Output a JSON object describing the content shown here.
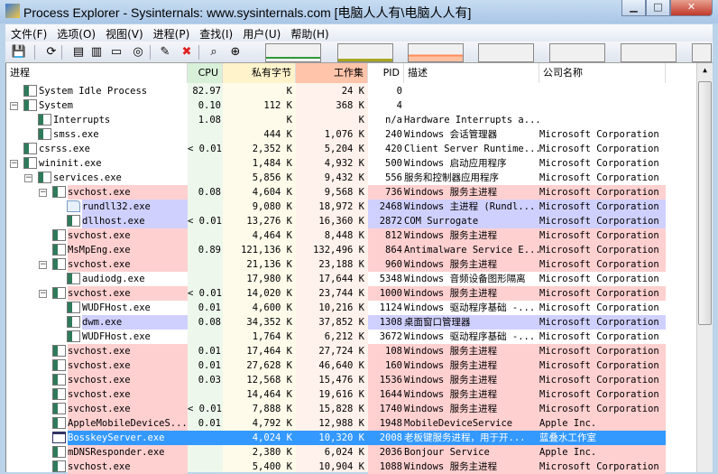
{
  "window": {
    "title": "Process Explorer - Sysinternals: www.sysinternals.com [电脑人人有\\电脑人人有]",
    "minimize": "▁",
    "maximize": "□",
    "close": "✕"
  },
  "menu": [
    "文件(F)",
    "选项(O)",
    "视图(V)",
    "进程(P)",
    "查找(I)",
    "用户(U)",
    "帮助(H)"
  ],
  "toolbar": [
    {
      "icon": "save-icon",
      "glyph": "💾"
    },
    {
      "icon": "refresh-icon",
      "glyph": "⟳"
    },
    {
      "icon": "system-info-icon",
      "glyph": "▤"
    },
    {
      "icon": "handles-icon",
      "glyph": "▥"
    },
    {
      "icon": "lower-pane-icon",
      "glyph": "▭"
    },
    {
      "icon": "properties-icon",
      "glyph": "◎"
    },
    {
      "icon": "window-icon",
      "glyph": "✎"
    },
    {
      "icon": "kill-process-icon",
      "glyph": "✖"
    },
    {
      "icon": "find-icon",
      "glyph": "⌕"
    },
    {
      "icon": "target-icon",
      "glyph": "⊕"
    }
  ],
  "colors": {
    "pink": "#ffd0d0",
    "purple": "#d0d0ff",
    "selected": "#3399ff",
    "cpu_hdr": "#d8f0d8",
    "cpu_col": "#edf7ec",
    "priv_hdr": "#fff3cc",
    "priv_col": "#fffbea",
    "ws_hdr": "#ffc4aa",
    "ws_col": "#fff1eb"
  },
  "columns": {
    "process": "进程",
    "cpu": "CPU",
    "private": "私有字节",
    "working": "工作集",
    "pid": "PID",
    "description": "描述",
    "company": "公司名称"
  },
  "processes": [
    {
      "name": "System Idle Process",
      "level": 0,
      "exp": "",
      "icon": "sys",
      "color": "",
      "cpu": "82.97",
      "priv": "K",
      "ws": "24 K",
      "pid": "0",
      "desc": "",
      "company": ""
    },
    {
      "name": "System",
      "level": 0,
      "exp": "−",
      "icon": "sys",
      "color": "",
      "cpu": "0.10",
      "priv": "112 K",
      "ws": "368 K",
      "pid": "4",
      "desc": "",
      "company": ""
    },
    {
      "name": "Interrupts",
      "level": 1,
      "exp": "",
      "icon": "sys",
      "color": "",
      "cpu": "1.08",
      "priv": "K",
      "ws": "K",
      "pid": "n/a",
      "desc": "Hardware Interrupts a...",
      "company": ""
    },
    {
      "name": "smss.exe",
      "level": 1,
      "exp": "",
      "icon": "app",
      "color": "",
      "cpu": "",
      "priv": "444 K",
      "ws": "1,076 K",
      "pid": "240",
      "desc": "Windows 会话管理器",
      "company": "Microsoft Corporation"
    },
    {
      "name": "csrss.exe",
      "level": 0,
      "exp": "",
      "icon": "app",
      "color": "",
      "cpu": "< 0.01",
      "priv": "2,352 K",
      "ws": "5,204 K",
      "pid": "420",
      "desc": "Client Server Runtime...",
      "company": "Microsoft Corporation"
    },
    {
      "name": "wininit.exe",
      "level": 0,
      "exp": "−",
      "icon": "app",
      "color": "",
      "cpu": "",
      "priv": "1,484 K",
      "ws": "4,932 K",
      "pid": "500",
      "desc": "Windows 启动应用程序",
      "company": "Microsoft Corporation"
    },
    {
      "name": "services.exe",
      "level": 1,
      "exp": "−",
      "icon": "app",
      "color": "",
      "cpu": "",
      "priv": "5,856 K",
      "ws": "9,432 K",
      "pid": "556",
      "desc": "服务和控制器应用程序",
      "company": "Microsoft Corporation"
    },
    {
      "name": "svchost.exe",
      "level": 2,
      "exp": "−",
      "icon": "app",
      "color": "pink",
      "cpu": "0.08",
      "priv": "4,604 K",
      "ws": "9,568 K",
      "pid": "736",
      "desc": "Windows 服务主进程",
      "company": "Microsoft Corporation"
    },
    {
      "name": "rundll32.exe",
      "level": 3,
      "exp": "",
      "icon": "doc",
      "color": "purple",
      "cpu": "",
      "priv": "9,080 K",
      "ws": "18,972 K",
      "pid": "2468",
      "desc": "Windows 主进程 (Rundl...",
      "company": "Microsoft Corporation"
    },
    {
      "name": "dllhost.exe",
      "level": 3,
      "exp": "",
      "icon": "app",
      "color": "purple",
      "cpu": "< 0.01",
      "priv": "13,276 K",
      "ws": "16,360 K",
      "pid": "2872",
      "desc": "COM Surrogate",
      "company": "Microsoft Corporation"
    },
    {
      "name": "svchost.exe",
      "level": 2,
      "exp": "",
      "icon": "app",
      "color": "pink",
      "cpu": "",
      "priv": "4,464 K",
      "ws": "8,448 K",
      "pid": "812",
      "desc": "Windows 服务主进程",
      "company": "Microsoft Corporation"
    },
    {
      "name": "MsMpEng.exe",
      "level": 2,
      "exp": "",
      "icon": "app",
      "color": "pink",
      "cpu": "0.89",
      "priv": "121,136 K",
      "ws": "132,496 K",
      "pid": "864",
      "desc": "Antimalware Service E...",
      "company": "Microsoft Corporation"
    },
    {
      "name": "svchost.exe",
      "level": 2,
      "exp": "−",
      "icon": "app",
      "color": "pink",
      "cpu": "",
      "priv": "21,136 K",
      "ws": "23,188 K",
      "pid": "960",
      "desc": "Windows 服务主进程",
      "company": "Microsoft Corporation"
    },
    {
      "name": "audiodg.exe",
      "level": 3,
      "exp": "",
      "icon": "app",
      "color": "",
      "cpu": "",
      "priv": "17,980 K",
      "ws": "17,644 K",
      "pid": "5348",
      "desc": "Windows 音频设备图形隔离",
      "company": "Microsoft Corporation"
    },
    {
      "name": "svchost.exe",
      "level": 2,
      "exp": "−",
      "icon": "app",
      "color": "pink",
      "cpu": "< 0.01",
      "priv": "14,020 K",
      "ws": "23,744 K",
      "pid": "1000",
      "desc": "Windows 服务主进程",
      "company": "Microsoft Corporation"
    },
    {
      "name": "WUDFHost.exe",
      "level": 3,
      "exp": "",
      "icon": "app",
      "color": "",
      "cpu": "0.01",
      "priv": "4,600 K",
      "ws": "10,216 K",
      "pid": "1124",
      "desc": "Windows 驱动程序基础 -...",
      "company": "Microsoft Corporation"
    },
    {
      "name": "dwm.exe",
      "level": 3,
      "exp": "",
      "icon": "app",
      "color": "purple",
      "cpu": "0.08",
      "priv": "34,352 K",
      "ws": "37,852 K",
      "pid": "1308",
      "desc": "桌面窗口管理器",
      "company": "Microsoft Corporation"
    },
    {
      "name": "WUDFHost.exe",
      "level": 3,
      "exp": "",
      "icon": "app",
      "color": "",
      "cpu": "",
      "priv": "1,764 K",
      "ws": "6,212 K",
      "pid": "3672",
      "desc": "Windows 驱动程序基础 -...",
      "company": "Microsoft Corporation"
    },
    {
      "name": "svchost.exe",
      "level": 2,
      "exp": "",
      "icon": "app",
      "color": "pink",
      "cpu": "0.01",
      "priv": "17,464 K",
      "ws": "27,724 K",
      "pid": "108",
      "desc": "Windows 服务主进程",
      "company": "Microsoft Corporation"
    },
    {
      "name": "svchost.exe",
      "level": 2,
      "exp": "",
      "icon": "app",
      "color": "pink",
      "cpu": "0.01",
      "priv": "27,628 K",
      "ws": "46,640 K",
      "pid": "160",
      "desc": "Windows 服务主进程",
      "company": "Microsoft Corporation"
    },
    {
      "name": "svchost.exe",
      "level": 2,
      "exp": "",
      "icon": "app",
      "color": "pink",
      "cpu": "0.03",
      "priv": "12,568 K",
      "ws": "15,476 K",
      "pid": "1536",
      "desc": "Windows 服务主进程",
      "company": "Microsoft Corporation"
    },
    {
      "name": "svchost.exe",
      "level": 2,
      "exp": "",
      "icon": "app",
      "color": "pink",
      "cpu": "",
      "priv": "14,464 K",
      "ws": "19,616 K",
      "pid": "1644",
      "desc": "Windows 服务主进程",
      "company": "Microsoft Corporation"
    },
    {
      "name": "svchost.exe",
      "level": 2,
      "exp": "",
      "icon": "app",
      "color": "pink",
      "cpu": "< 0.01",
      "priv": "7,888 K",
      "ws": "15,828 K",
      "pid": "1740",
      "desc": "Windows 服务主进程",
      "company": "Microsoft Corporation"
    },
    {
      "name": "AppleMobileDeviceS...",
      "level": 2,
      "exp": "",
      "icon": "app",
      "color": "pink",
      "cpu": "0.01",
      "priv": "4,792 K",
      "ws": "12,988 K",
      "pid": "1948",
      "desc": "MobileDeviceService",
      "company": "Apple Inc."
    },
    {
      "name": "BosskeyServer.exe",
      "level": 2,
      "exp": "",
      "icon": "win",
      "color": "selected",
      "cpu": "",
      "priv": "4,024 K",
      "ws": "10,320 K",
      "pid": "2008",
      "desc": "老板键服务进程，用于开...",
      "company": "蓝叠水工作室"
    },
    {
      "name": "mDNSResponder.exe",
      "level": 2,
      "exp": "",
      "icon": "app",
      "color": "pink",
      "cpu": "",
      "priv": "2,380 K",
      "ws": "6,024 K",
      "pid": "2036",
      "desc": "Bonjour Service",
      "company": "Apple Inc."
    },
    {
      "name": "svchost.exe",
      "level": 2,
      "exp": "",
      "icon": "app",
      "color": "pink",
      "cpu": "",
      "priv": "5,400 K",
      "ws": "10,904 K",
      "pid": "1088",
      "desc": "Windows 服务主进程",
      "company": "Microsoft Corporation"
    }
  ]
}
